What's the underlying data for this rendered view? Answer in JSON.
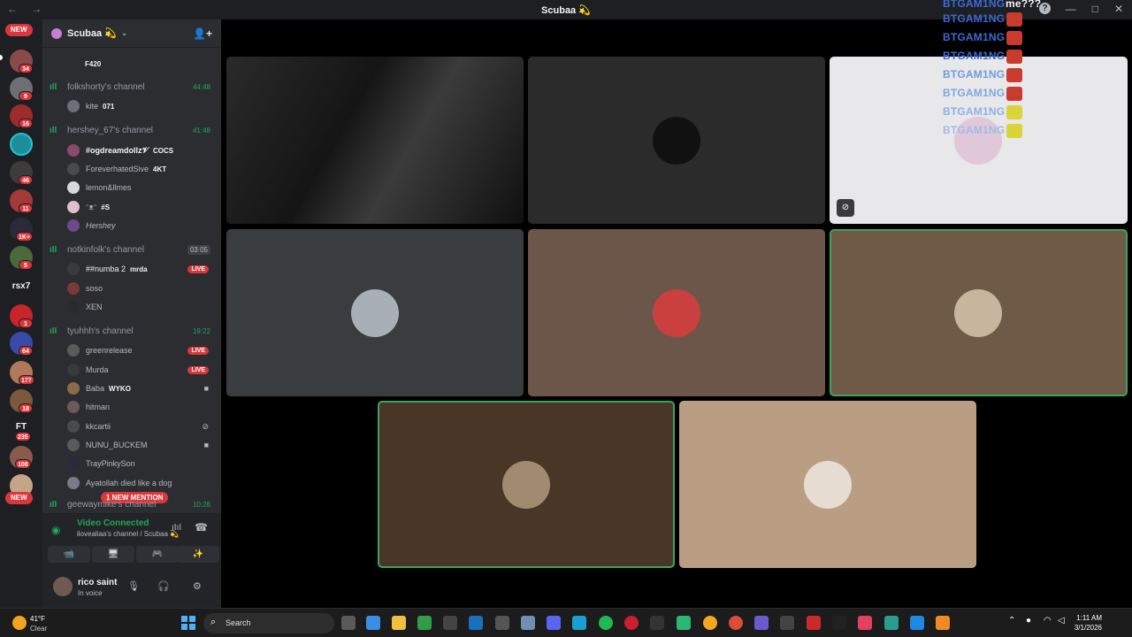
{
  "titlebar": {
    "nav": "← →",
    "title": "Scubaa 💫",
    "help": "?",
    "minimize": "—",
    "maximize": "□",
    "close": "✕"
  },
  "servers": {
    "new_top": "NEW",
    "new_bottom": "NEW",
    "badges": [
      "1",
      "34",
      "9",
      "16",
      "46",
      "11",
      "1K+",
      "5",
      "1",
      "64",
      "177",
      "18",
      "235",
      "108"
    ],
    "text_items": [
      "rsx7",
      "FT"
    ]
  },
  "guild": {
    "name": "Scubaa 💫",
    "chevron": "⌄",
    "add_member_icon": "👤+"
  },
  "channels": [
    {
      "name": "folkshorty's channel",
      "timer": "44:48"
    },
    {
      "name": "hershey_67's channel",
      "timer": "41:48"
    },
    {
      "name": "notkinfolk's channel",
      "timer": "03  05"
    },
    {
      "name": "tyuhhh's channel",
      "timer": "19:22"
    },
    {
      "name": "geewaymike's channel",
      "timer": "10:28"
    }
  ],
  "members": {
    "partial_top": "F420",
    "folk": [
      {
        "name": "kite",
        "tag": "071"
      }
    ],
    "hershey": [
      {
        "name": "#ogdreamdollz𝓥",
        "tag": "COCS"
      },
      {
        "name": "ForeverhatedSive",
        "tag": "4KT"
      },
      {
        "name": "lemon&llmes",
        "tag": ""
      },
      {
        "name": "ᵔᴥᵔ",
        "tag": "#S"
      },
      {
        "name": "Hershey",
        "tag": ""
      }
    ],
    "notkin": [
      {
        "name": "##numba 2",
        "tag": "mrda",
        "live": "LIVE"
      },
      {
        "name": "soso",
        "tag": ""
      },
      {
        "name": "XEN",
        "tag": ""
      }
    ],
    "tyuhhh": [
      {
        "name": "greenrelease",
        "tag": "",
        "live": "LIVE"
      },
      {
        "name": "Murda",
        "tag": "",
        "live": "LIVE"
      },
      {
        "name": "Baba",
        "tag": "WYKO"
      },
      {
        "name": "hitman",
        "tag": ""
      },
      {
        "name": "kkcartii",
        "tag": ""
      },
      {
        "name": "NUNU_BUCKEM",
        "tag": ""
      },
      {
        "name": "TrayPinkySon",
        "tag": ""
      },
      {
        "name": "Ayatollah died like a dog",
        "tag": ""
      }
    ]
  },
  "mention_pill": "1 NEW MENTION",
  "voice": {
    "status": "Video Connected",
    "location": "ilovealiaa's channel / Scubaa 💫",
    "camera_icon": "📹",
    "share_icon": "🖥",
    "activity_icon": "🎮",
    "soundboard_icon": "✨"
  },
  "user": {
    "name": "rico saint",
    "status": "In voice",
    "mic_icon": "🎙",
    "headset_icon": "🎧",
    "settings_icon": "⚙"
  },
  "overlay": {
    "top_text": "me???",
    "lines": [
      "BTGAM1NG",
      "BTGAM1NG",
      "BTGAM1NG",
      "BTGAM1NG",
      "BTGAM1NG",
      "BTGAM1NG",
      "BTGAM1NG",
      "BTGAM1NG"
    ]
  },
  "colors": {
    "accent_green": "#3aa55d",
    "live_red": "#da373c",
    "overlay_blue": "#3b6bd7"
  },
  "taskbar": {
    "temperature": "41°F",
    "condition": "Clear",
    "search_label": "Search",
    "time": "1:11 AM",
    "date": "3/1/2026"
  }
}
